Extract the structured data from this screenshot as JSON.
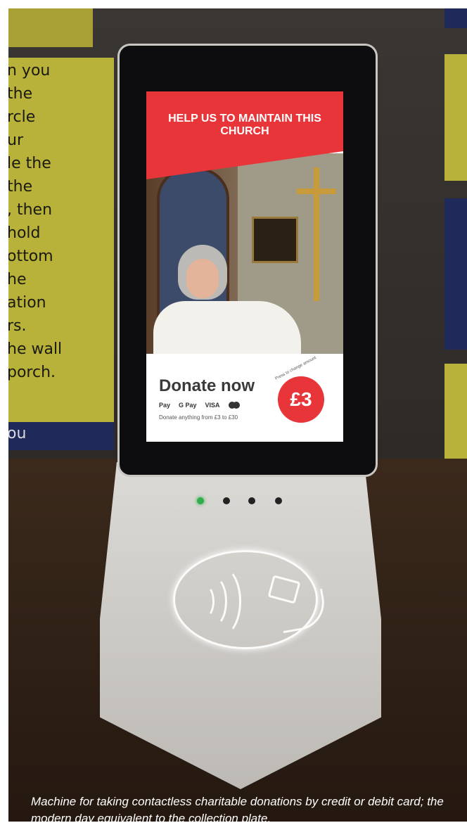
{
  "background_poster": {
    "left_lines": [
      "n you",
      " the",
      "rcle",
      "ur",
      "le the",
      "the",
      ", then",
      "hold",
      "ottom",
      "he",
      "ation",
      "rs."
    ],
    "left_lower": [
      "he wall",
      " porch."
    ],
    "left_bar_text": "ou"
  },
  "screen": {
    "banner_title": "HELP US TO MAINTAIN THIS CHURCH",
    "donate_title": "Donate now",
    "payment_methods": [
      "Pay",
      "G Pay",
      "VISA"
    ],
    "donate_range": "Donate anything from £3 to £30",
    "amount": "£3",
    "amount_caption": "Press to change amount"
  },
  "device": {
    "led_count": 4,
    "led_active_index": 0,
    "led_active_color": "#2fae4a",
    "contactless_icon": "contactless-card-tap-icon"
  },
  "caption": "Machine  for taking contactless charitable donations by credit or debit card; the modern day equivalent to the collection plate.",
  "colors": {
    "brand_red": "#e8353a",
    "poster_yellow": "#b9b23a",
    "poster_navy": "#1f2a5a"
  }
}
